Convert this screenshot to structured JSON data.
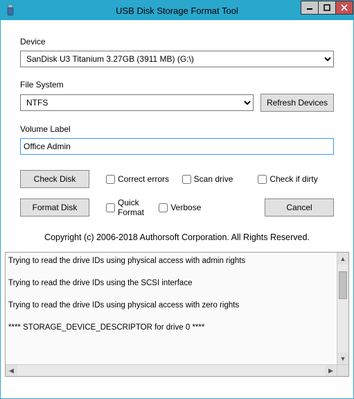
{
  "window": {
    "title": "USB Disk Storage Format Tool"
  },
  "labels": {
    "device": "Device",
    "filesystem": "File System",
    "volumelabel": "Volume Label"
  },
  "device": {
    "selected": "SanDisk U3 Titanium 3.27GB (3911 MB)  (G:\\)"
  },
  "filesystem": {
    "selected": "NTFS"
  },
  "buttons": {
    "refresh": "Refresh Devices",
    "checkdisk": "Check Disk",
    "formatdisk": "Format Disk",
    "cancel": "Cancel"
  },
  "volume": {
    "value": "Office Admin"
  },
  "checks": {
    "correct": "Correct errors",
    "scan": "Scan drive",
    "dirty": "Check if dirty",
    "quick": "Quick Format",
    "verbose": "Verbose"
  },
  "copyright": "Copyright (c) 2006-2018 Authorsoft Corporation. All Rights Reserved.",
  "log": {
    "lines": [
      "Trying to read the drive IDs using physical access with admin rights",
      "Trying to read the drive IDs using the SCSI interface",
      "Trying to read the drive IDs using physical access with zero rights",
      "**** STORAGE_DEVICE_DESCRIPTOR for drive 0 ****"
    ]
  }
}
